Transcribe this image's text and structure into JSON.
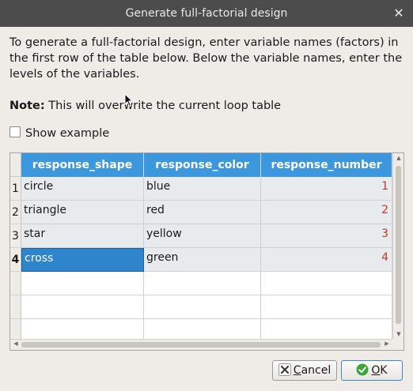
{
  "window": {
    "title": "Generate full-factorial design",
    "close_icon": "close-icon"
  },
  "intro_text": "To generate a full-factorial design, enter variable names (factors) in the first row of the table below. Below the variable names, enter the levels of the variables.",
  "note": {
    "label": "Note:",
    "text": " This will overwrite the current loop table"
  },
  "show_example": {
    "label": "Show example",
    "checked": false
  },
  "table": {
    "columns": [
      "response_shape",
      "response_color",
      "response_number"
    ],
    "row_numbers": [
      "1",
      "2",
      "3",
      "4"
    ],
    "rows": [
      [
        "circle",
        "blue",
        "1"
      ],
      [
        "triangle",
        "red",
        "2"
      ],
      [
        "star",
        "yellow",
        "3"
      ],
      [
        "cross",
        "green",
        "4"
      ]
    ],
    "selected_cell": "cross",
    "header_color": "#3c97dc",
    "number_color": "#c0392b"
  },
  "buttons": {
    "cancel": {
      "mnemonic": "C",
      "rest": "ancel",
      "icon": "cancel-icon"
    },
    "ok": {
      "mnemonic": "O",
      "rest": "K",
      "icon": "ok-check-icon"
    }
  }
}
